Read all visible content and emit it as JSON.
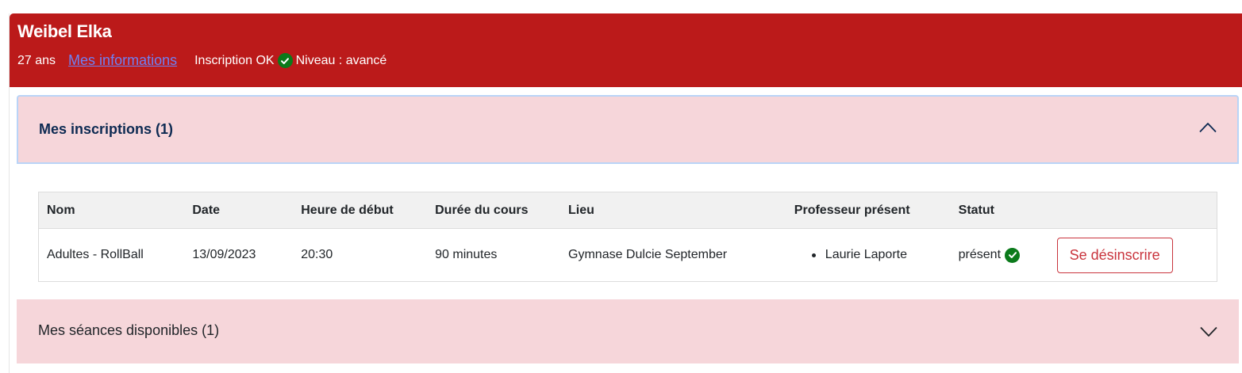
{
  "profile": {
    "name": "Weibel Elka",
    "age": "27 ans",
    "info_link": "Mes informations",
    "registration_status": "Inscription OK",
    "level": "Niveau : avancé"
  },
  "registrations": {
    "title": "Mes inscriptions (1)",
    "expanded": true,
    "columns": [
      "Nom",
      "Date",
      "Heure de début",
      "Durée du cours",
      "Lieu",
      "Professeur présent",
      "Statut"
    ],
    "rows": [
      {
        "name": "Adultes - RollBall",
        "date": "13/09/2023",
        "start": "20:30",
        "duration": "90 minutes",
        "place": "Gymnase Dulcie September",
        "teacher": "Laurie Laporte",
        "status": "présent",
        "action": "Se désinscrire"
      }
    ]
  },
  "available": {
    "title": "Mes séances disponibles (1)",
    "expanded": false
  },
  "colors": {
    "header_bg": "#bb1a1a",
    "accordion_bg": "#f6d6da",
    "success": "#0b7a1b",
    "danger": "#c9343d",
    "link": "#6f80f3"
  }
}
